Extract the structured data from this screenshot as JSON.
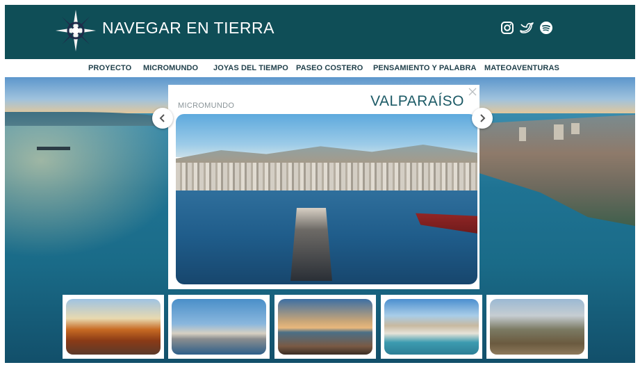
{
  "site": {
    "title": "NAVEGAR EN TIERRA",
    "logo_icon": "compass-rose-icon",
    "socials": [
      {
        "name": "instagram-icon"
      },
      {
        "name": "twitter-icon"
      },
      {
        "name": "spotify-icon"
      }
    ]
  },
  "nav": {
    "items": [
      {
        "label": "PROYECTO"
      },
      {
        "label": "MICROMUNDO"
      },
      {
        "label": "JOYAS DEL TIEMPO"
      },
      {
        "label": "PASEO COSTERO"
      },
      {
        "label": "PENSAMIENTO Y PALABRA"
      },
      {
        "label": "MATEOAVENTURAS"
      }
    ]
  },
  "modal": {
    "category": "MICROMUNDO",
    "title": "VALPARAÍSO",
    "close_icon": "close-icon",
    "prev_icon": "chevron-left-icon",
    "next_icon": "chevron-right-icon"
  },
  "thumbnails": [
    {
      "subject": "autumn-forest"
    },
    {
      "subject": "marina-sailboats"
    },
    {
      "subject": "lighthouse-rocks"
    },
    {
      "subject": "coastal-cliffs"
    },
    {
      "subject": "dirt-road-trees"
    }
  ],
  "colors": {
    "header_bg": "#0f4e57",
    "accent": "#1c5a66",
    "nav_text": "#1f3f4a"
  }
}
